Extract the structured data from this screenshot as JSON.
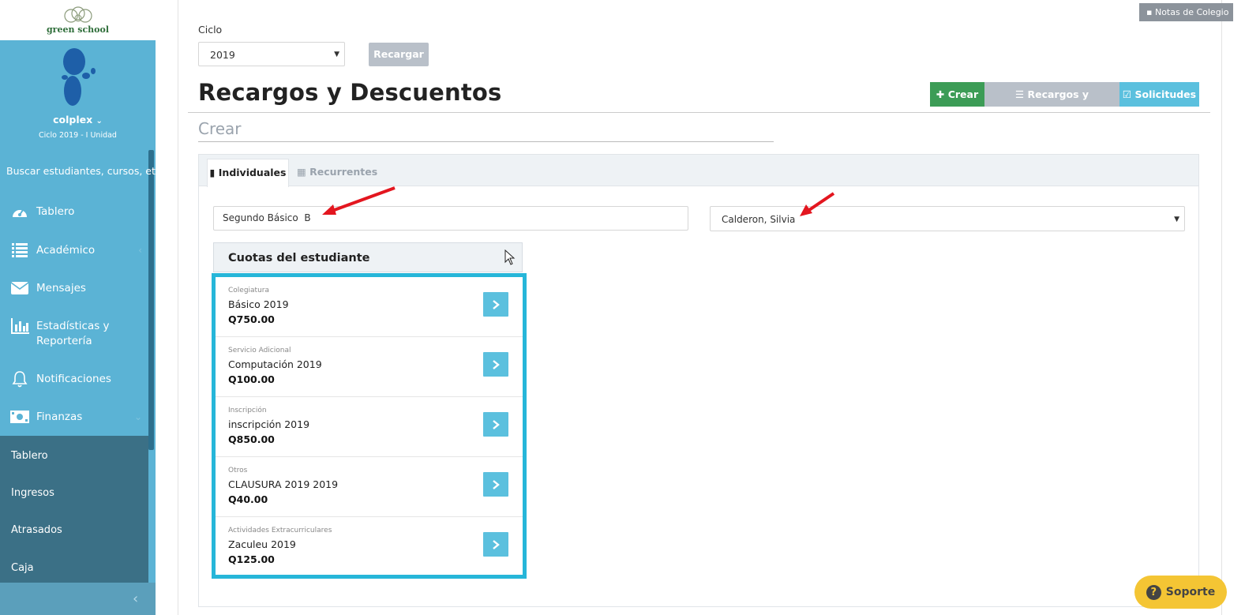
{
  "sidebar": {
    "logo_text": "green school",
    "user_name": "colplex",
    "cycle_info": "Ciclo 2019 - I Unidad",
    "search_placeholder": "Buscar estudiantes, cursos, etc...",
    "nav_items": [
      {
        "label": "Tablero",
        "icon": "dashboard-icon"
      },
      {
        "label": "Académico",
        "icon": "list-icon"
      },
      {
        "label": "Mensajes",
        "icon": "envelope-icon"
      },
      {
        "label_line1": "Estadísticas y",
        "label_line2": "Reportería",
        "icon": "bar-chart-icon"
      },
      {
        "label": "Notificaciones",
        "icon": "bell-icon"
      },
      {
        "label": "Finanzas",
        "icon": "money-icon"
      }
    ],
    "submenu": [
      "Tablero",
      "Ingresos",
      "Atrasados",
      "Caja"
    ]
  },
  "top": {
    "notes_label": "Notas de Colegio",
    "ciclo_label": "Ciclo",
    "ciclo_value": "2019",
    "reload_label": "Recargar"
  },
  "page": {
    "title": "Recargos y Descuentos",
    "section": "Crear",
    "toolbar": {
      "create": "Crear",
      "recargos": "Recargos y Descuentos",
      "solicitudes": "Solicitudes"
    }
  },
  "tabs": {
    "individual": "Individuales",
    "recurrent": "Recurrentes"
  },
  "student": {
    "course": "Segundo Básico  B",
    "name": "Calderon, Silvia"
  },
  "fees": {
    "title": "Cuotas del estudiante",
    "items": [
      {
        "category": "Colegiatura",
        "name": "Básico 2019",
        "amount": "Q750.00"
      },
      {
        "category": "Servicio Adicional",
        "name": "Computación 2019",
        "amount": "Q100.00"
      },
      {
        "category": "Inscripción",
        "name": "inscripción 2019",
        "amount": "Q850.00"
      },
      {
        "category": "Otros",
        "name": "CLAUSURA 2019 2019",
        "amount": "Q40.00"
      },
      {
        "category": "Actividades Extracurriculares",
        "name": "Zaculeu 2019",
        "amount": "Q125.00"
      }
    ]
  },
  "support_label": "Soporte",
  "colors": {
    "sidebar": "#5bb3d5",
    "submenu": "#3b7086",
    "create": "#3c9c56",
    "info": "#5bc0de",
    "highlight": "#26b6d9",
    "annotation_arrow": "#e3161f",
    "support": "#f4c534"
  }
}
